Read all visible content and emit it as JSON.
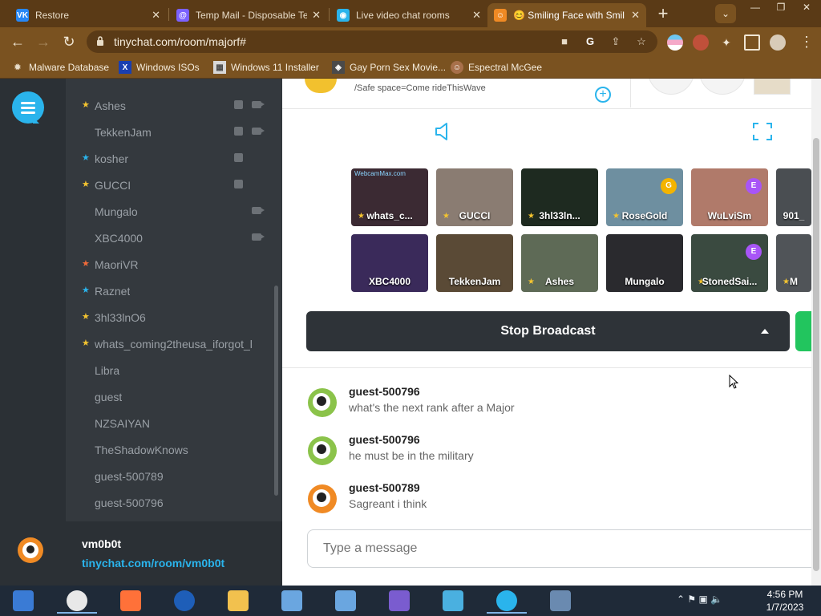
{
  "tabs": [
    {
      "title": "Restore",
      "favicon": "VK",
      "color": "#2787f5",
      "active": false
    },
    {
      "title": "Temp Mail - Disposable Te",
      "favicon": "@",
      "color": "#7b61ff",
      "active": false
    },
    {
      "title": "Live video chat rooms",
      "favicon": "◉",
      "color": "#2ab4ec",
      "active": false
    },
    {
      "title": "😊 Smiling Face with Smil",
      "favicon": "☺",
      "color": "#f08a24",
      "active": true
    }
  ],
  "toolbar": {
    "url": "tinychat.com/room/majorf#"
  },
  "bookmarks": [
    {
      "label": "Malware Database",
      "icon": "virus-icon"
    },
    {
      "label": "Windows ISOs",
      "icon": "x-icon"
    },
    {
      "label": "Windows 11 Installer",
      "icon": "image-icon"
    },
    {
      "label": "Gay Porn Sex Movie...",
      "icon": "site-icon"
    },
    {
      "label": "Espectral McGee",
      "icon": "avatar-icon"
    }
  ],
  "users": [
    {
      "name": "Ashes",
      "star": "#f4c430",
      "mic": true,
      "cam": true
    },
    {
      "name": "TekkenJam",
      "star": null,
      "mic": true,
      "cam": true
    },
    {
      "name": "kosher",
      "star": "#2ab4ec",
      "mic": true,
      "cam": false
    },
    {
      "name": "GUCCI",
      "star": "#f4c430",
      "mic": true,
      "cam": false
    },
    {
      "name": "Mungalo",
      "star": null,
      "mic": false,
      "cam": true
    },
    {
      "name": "XBC4000",
      "star": null,
      "mic": false,
      "cam": true
    },
    {
      "name": "MaoriVR",
      "star": "#f26b3a",
      "mic": false,
      "cam": false
    },
    {
      "name": "Raznet",
      "star": "#2ab4ec",
      "mic": false,
      "cam": false
    },
    {
      "name": "3hl33lnO6",
      "star": "#f4c430",
      "mic": false,
      "cam": false
    },
    {
      "name": "whats_coming2theusa_iforgot_l",
      "star": "#f4c430",
      "mic": false,
      "cam": false
    },
    {
      "name": "Libra",
      "star": null,
      "mic": false,
      "cam": false
    },
    {
      "name": "guest",
      "star": null,
      "mic": false,
      "cam": false
    },
    {
      "name": "NZSAIYAN",
      "star": null,
      "mic": false,
      "cam": false
    },
    {
      "name": "TheShadowKnows",
      "star": null,
      "mic": false,
      "cam": false
    },
    {
      "name": "guest-500789",
      "star": null,
      "mic": false,
      "cam": false
    },
    {
      "name": "guest-500796",
      "star": null,
      "mic": false,
      "cam": false
    }
  ],
  "me": {
    "name": "vm0b0t",
    "link": "tinychat.com/room/vm0b0t"
  },
  "room": {
    "description": "/Safe space=Come rideThisWave"
  },
  "cams": [
    {
      "name": "whats_c...",
      "star": true,
      "badge": null,
      "bg": "#3b2a33",
      "watermark": "WebcamMax.com"
    },
    {
      "name": "GUCCI",
      "star": true,
      "badge": null,
      "bg": "#8a7c72",
      "watermark": ""
    },
    {
      "name": "3hl33ln...",
      "star": true,
      "badge": null,
      "bg": "#1e2a20",
      "watermark": ""
    },
    {
      "name": "RoseGold",
      "star": true,
      "badge": "G",
      "badge_color": "#f4b400",
      "bg": "#6e8fa0",
      "watermark": ""
    },
    {
      "name": "WuLviSm",
      "star": false,
      "badge": "E",
      "badge_color": "#a855f7",
      "bg": "#b07a6a",
      "watermark": ""
    },
    {
      "name": "901_",
      "star": false,
      "badge": null,
      "bg": "#4a4e52",
      "watermark": ""
    },
    {
      "name": "XBC4000",
      "star": false,
      "badge": null,
      "bg": "#3a2a5a",
      "watermark": ""
    },
    {
      "name": "TekkenJam",
      "star": false,
      "badge": null,
      "bg": "#5a4a36",
      "watermark": ""
    },
    {
      "name": "Ashes",
      "star": true,
      "badge": null,
      "bg": "#5e6a56",
      "watermark": ""
    },
    {
      "name": "Mungalo",
      "star": false,
      "badge": null,
      "bg": "#2a2a2e",
      "watermark": ""
    },
    {
      "name": "StonedSai...",
      "star": true,
      "badge": "E",
      "badge_color": "#a855f7",
      "bg": "#3a4a40",
      "watermark": ""
    },
    {
      "name": "M",
      "star": true,
      "badge": null,
      "bg": "#505458",
      "watermark": ""
    }
  ],
  "broadcast": {
    "label": "Stop Broadcast"
  },
  "messages": [
    {
      "author": "guest-500796",
      "text": "what's the next rank after a Major",
      "avatar_color": "#8bc34a"
    },
    {
      "author": "guest-500796",
      "text": "he must be in the military",
      "avatar_color": "#8bc34a"
    },
    {
      "author": "guest-500789",
      "text": "Sagreant i think",
      "avatar_color": "#f08a24"
    }
  ],
  "chat": {
    "placeholder": "Type a message"
  },
  "taskbar": {
    "apps": [
      "start-icon",
      "chrome-icon",
      "firefox-icon",
      "obama-logo-icon",
      "file-explorer-icon",
      "network-computer-icon",
      "network-computer-icon",
      "users-icon",
      "photos-icon",
      "tinychat-icon",
      "control-panel-icon"
    ],
    "time": "4:56 PM",
    "date": "1/7/2023"
  }
}
